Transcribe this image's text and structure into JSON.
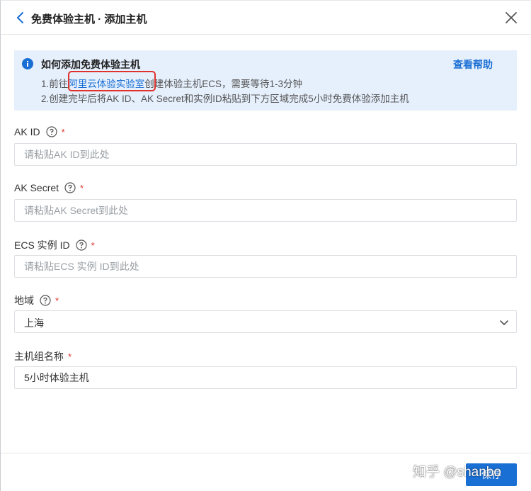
{
  "header": {
    "title": "免费体验主机 · 添加主机"
  },
  "info": {
    "title": "如何添加免费体验主机",
    "help_label": "查看帮助",
    "line1_prefix": "1.前往",
    "line1_link": "阿里云体验实验室",
    "line1_suffix": "创建体验主机ECS，需要等待1-3分钟",
    "line2": "2.创建完毕后将AK ID、AK Secret和实例ID粘贴到下方区域完成5小时免费体验添加主机"
  },
  "form": {
    "ak_id": {
      "label": "AK ID",
      "required": "*",
      "placeholder": "请粘贴AK ID到此处",
      "value": ""
    },
    "ak_secret": {
      "label": "AK Secret",
      "required": "*",
      "placeholder": "请粘贴AK Secret到此处",
      "value": ""
    },
    "ecs_id": {
      "label": "ECS 实例 ID",
      "required": "*",
      "placeholder": "请粘贴ECS 实例 ID到此处",
      "value": ""
    },
    "region": {
      "label": "地域",
      "required": "*",
      "value": "上海"
    },
    "group_name": {
      "label": "主机组名称",
      "required": "*",
      "value": "5小时体验主机"
    }
  },
  "footer": {
    "save_label": "保存"
  },
  "watermark": "知乎 @shanbo",
  "colors": {
    "accent": "#1a6fd4",
    "info_bg": "#e6f0fd",
    "required": "#e0322b",
    "highlight_box": "#e0322b"
  },
  "icons": {
    "back": "chevron-left-icon",
    "close": "close-icon",
    "info": "info-icon",
    "help": "question-circle-icon",
    "dropdown": "chevron-down-icon"
  }
}
